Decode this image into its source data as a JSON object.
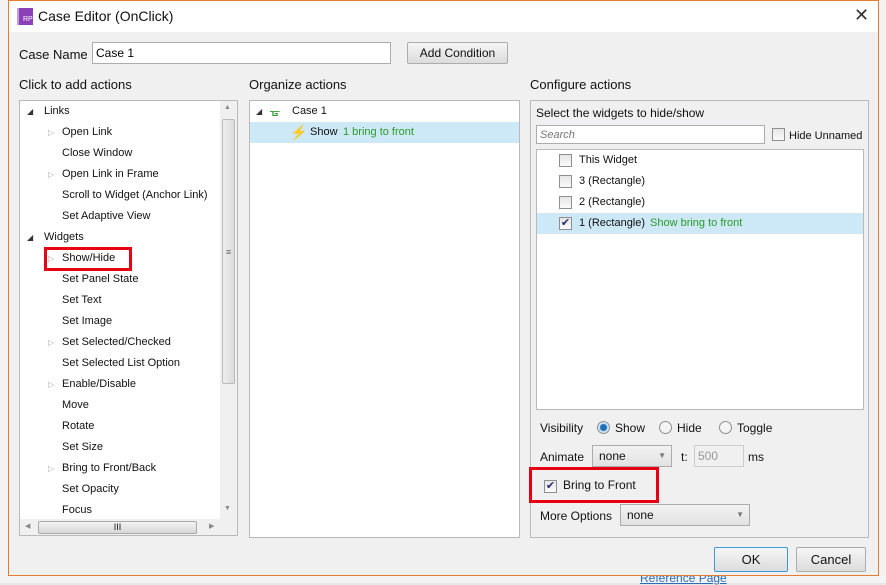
{
  "dialog": {
    "title": "Case Editor (OnClick)",
    "logo": "RP",
    "close_icon": "close-icon"
  },
  "case_name": {
    "label": "Case Name",
    "value": "Case 1",
    "add_condition": "Add Condition"
  },
  "left": {
    "heading": "Click to add actions",
    "items": [
      {
        "label": "Links",
        "level": 0,
        "expander": "expanded"
      },
      {
        "label": "Open Link",
        "level": 1,
        "expander": "collapsed"
      },
      {
        "label": "Close Window",
        "level": 1,
        "expander": "none"
      },
      {
        "label": "Open Link in Frame",
        "level": 1,
        "expander": "collapsed"
      },
      {
        "label": "Scroll to Widget (Anchor Link)",
        "level": 1,
        "expander": "none"
      },
      {
        "label": "Set Adaptive View",
        "level": 1,
        "expander": "none"
      },
      {
        "label": "Widgets",
        "level": 0,
        "expander": "expanded"
      },
      {
        "label": "Show/Hide",
        "level": 1,
        "expander": "collapsed",
        "highlighted": true
      },
      {
        "label": "Set Panel State",
        "level": 1,
        "expander": "none"
      },
      {
        "label": "Set Text",
        "level": 1,
        "expander": "none"
      },
      {
        "label": "Set Image",
        "level": 1,
        "expander": "none"
      },
      {
        "label": "Set Selected/Checked",
        "level": 1,
        "expander": "collapsed"
      },
      {
        "label": "Set Selected List Option",
        "level": 1,
        "expander": "none"
      },
      {
        "label": "Enable/Disable",
        "level": 1,
        "expander": "collapsed"
      },
      {
        "label": "Move",
        "level": 1,
        "expander": "none"
      },
      {
        "label": "Rotate",
        "level": 1,
        "expander": "none"
      },
      {
        "label": "Set Size",
        "level": 1,
        "expander": "none"
      },
      {
        "label": "Bring to Front/Back",
        "level": 1,
        "expander": "collapsed"
      },
      {
        "label": "Set Opacity",
        "level": 1,
        "expander": "none"
      },
      {
        "label": "Focus",
        "level": 1,
        "expander": "none"
      }
    ]
  },
  "middle": {
    "heading": "Organize actions",
    "case_label": "Case 1",
    "action_verb": "Show",
    "action_detail": "1 bring to front"
  },
  "right": {
    "heading": "Configure actions",
    "subheading": "Select the widgets to hide/show",
    "search_placeholder": "Search",
    "hide_unnamed": "Hide Unnamed",
    "widgets": [
      {
        "label": "This Widget",
        "checked": false,
        "note": ""
      },
      {
        "label": "3 (Rectangle)",
        "checked": false,
        "note": ""
      },
      {
        "label": "2 (Rectangle)",
        "checked": false,
        "note": ""
      },
      {
        "label": "1 (Rectangle)",
        "checked": true,
        "note": "Show bring to front"
      }
    ],
    "visibility_label": "Visibility",
    "visibility_options": [
      "Show",
      "Hide",
      "Toggle"
    ],
    "visibility_selected": "Show",
    "animate_label": "Animate",
    "animate_value": "none",
    "t_label": "t:",
    "t_value": "500",
    "ms": "ms",
    "bring_to_front": "Bring to Front",
    "bring_to_front_checked": true,
    "more_options_label": "More Options",
    "more_options_value": "none"
  },
  "buttons": {
    "ok": "OK",
    "cancel": "Cancel"
  },
  "background": {
    "link": "Reference Page"
  },
  "colors": {
    "accent_border": "#e87b2c",
    "highlight": "#e60012",
    "selection": "#cde8f6",
    "green_text": "#2a9a2a"
  }
}
